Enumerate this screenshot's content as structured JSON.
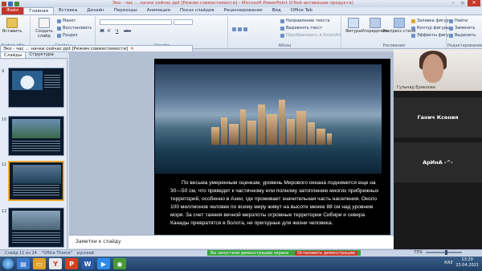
{
  "window": {
    "title": "Эко - час ... начки сейчас.ppt [Режим совместимости] - Microsoft PowerPoint (Сбой активации продукта)"
  },
  "ribbon_tabs": {
    "file": "Файл",
    "items": [
      "Главная",
      "Вставка",
      "Дизайн",
      "Переходы",
      "Анимация",
      "Показ слайдов",
      "Рецензирование",
      "Вид",
      "Office Tab"
    ]
  },
  "ribbon": {
    "paste": "Вставить",
    "new_slide": "Создать слайд",
    "layout": "Макет",
    "reset": "Восстановить",
    "section": "Раздел",
    "buffer_group": "Буфер обм...",
    "slides_group": "Слайды",
    "font_group": "Шрифт",
    "text_direction": "Направление текста",
    "align_text": "Выровнять текст",
    "smartart": "Преобразовать в SmartArt",
    "paragraph_group": "Абзац",
    "figures": "Фигуры",
    "arrange": "Упорядочить",
    "express_styles": "Экспресс-стили",
    "shape_fill": "Заливка фигуры",
    "shape_outline": "Контур фигуры",
    "shape_effects": "Эффекты фигур",
    "drawing_group": "Рисование",
    "find": "Найти",
    "replace": "Заменить",
    "select": "Выделить",
    "editing_group": "Редактирование"
  },
  "document_tab": "Эко - час ... начки сейчас.ppt [Режим совместимости]",
  "slide_panel": {
    "tab_slides": "Слайды",
    "tab_outline": "Структура",
    "thumb_numbers": [
      "9",
      "10",
      "11",
      "12"
    ]
  },
  "slide": {
    "text": "По весьма умеренным оценкам, уровень Мирового океана поднимется еще на 30—50 см, что приведет к частичному или полному затоплению многих прибрежных территорий, особенно в Азии, где проживает значительная часть населения. Около 100 миллионов человек по всему миру живут на высоте менее 88 см над уровнем моря. За счет таяния вечной мерзлоты огромные территории Сибири и севера Канады превратятся в болота, не пригодные для жизни человека."
  },
  "notes": {
    "placeholder": "Заметки к слайду"
  },
  "video_panel": {
    "participant_camera": "Гульнар Ерикхова",
    "participant_2": "Ганич Ксения",
    "participant_3": "АрИнА -^-"
  },
  "status_bar": {
    "slide_info": "Слайд 11 из 24",
    "theme": "\"Office Theme\"",
    "language": "русский",
    "share_status": "Вы запустили демонстрацию экрана",
    "stop_share": "Остановить демонстрацию",
    "zoom": "73%"
  },
  "taskbar": {
    "lang": "КАЗ",
    "time": "13:20",
    "date": "23.04.2021"
  }
}
